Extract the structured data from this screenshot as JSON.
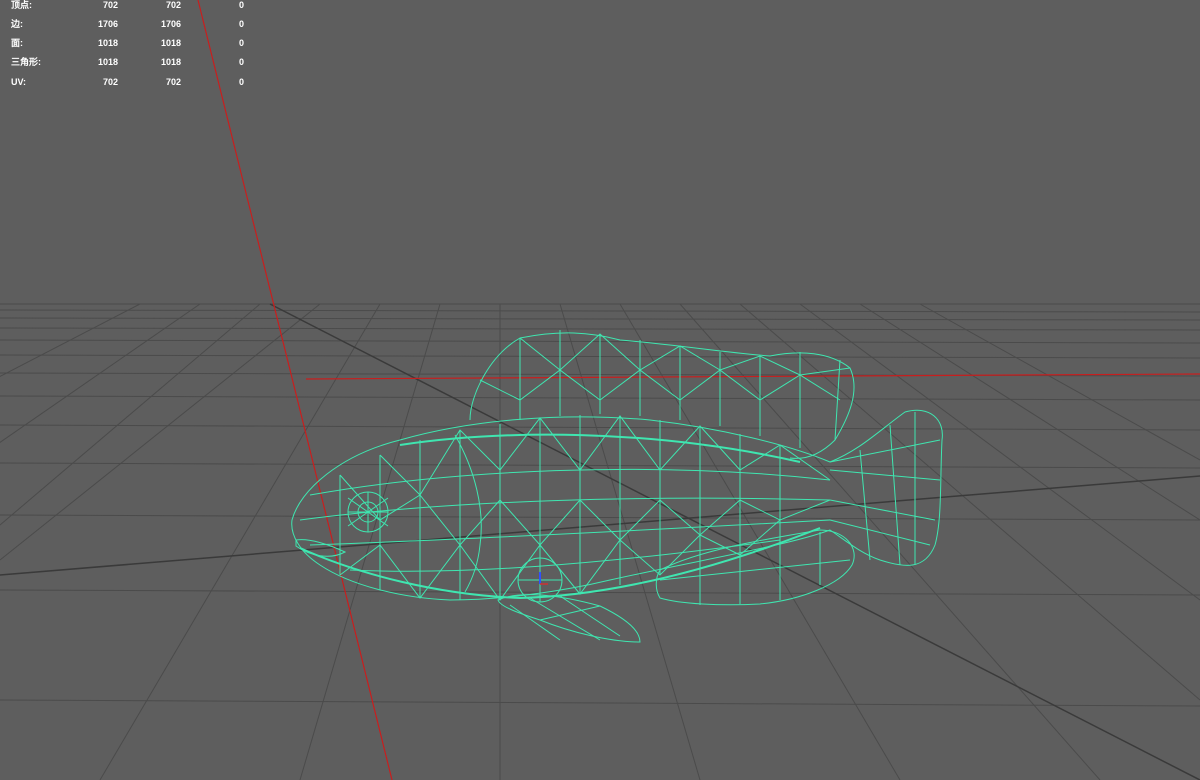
{
  "viewport": {
    "background_color": "#5e5e5e",
    "grid_color": "#4a4a4a",
    "axis_color": "#c81e1e",
    "wireframe_color": "#3fe6b0",
    "model_name": "fish-wireframe-model"
  },
  "hud": {
    "rows": [
      {
        "label": "顶点:",
        "values": [
          "702",
          "702",
          "0"
        ]
      },
      {
        "label": "边:",
        "values": [
          "1706",
          "1706",
          "0"
        ]
      },
      {
        "label": "面:",
        "values": [
          "1018",
          "1018",
          "0"
        ]
      },
      {
        "label": "三角形:",
        "values": [
          "1018",
          "1018",
          "0"
        ]
      },
      {
        "label": "UV:",
        "values": [
          "702",
          "702",
          "0"
        ]
      }
    ]
  }
}
